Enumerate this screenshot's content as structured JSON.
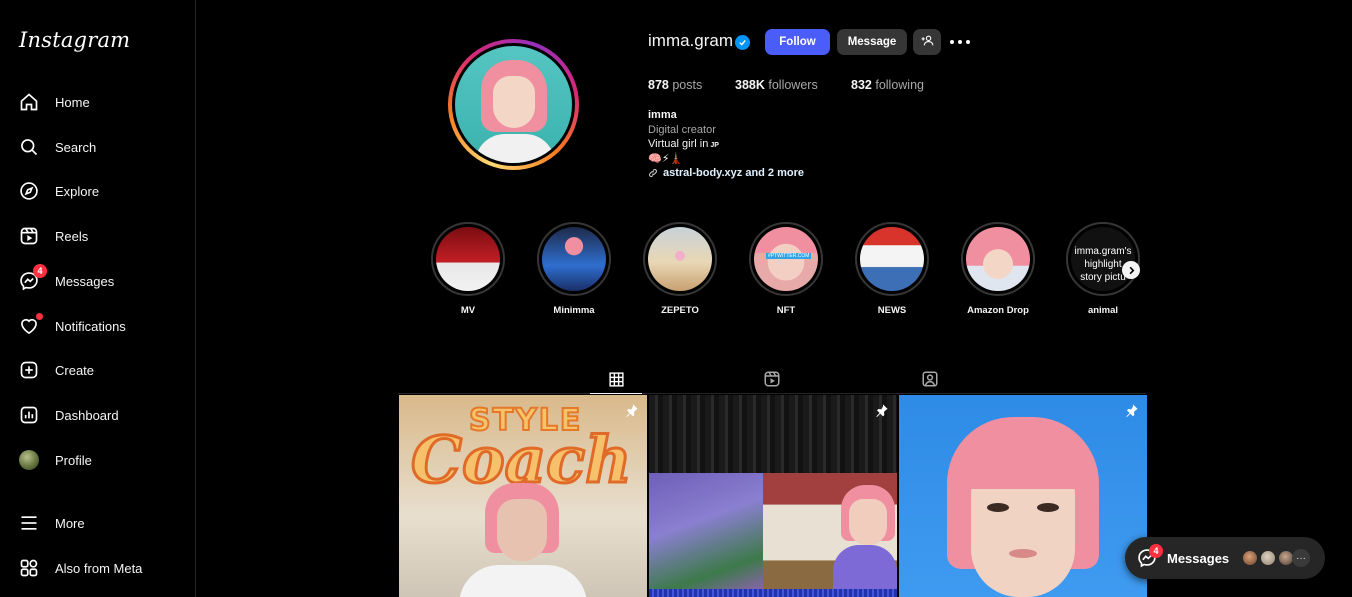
{
  "sidebar": {
    "logo": "Instagram",
    "items": [
      {
        "label": "Home",
        "icon": "home-icon"
      },
      {
        "label": "Search",
        "icon": "search-icon"
      },
      {
        "label": "Explore",
        "icon": "compass-icon"
      },
      {
        "label": "Reels",
        "icon": "reels-icon"
      },
      {
        "label": "Messages",
        "icon": "messenger-icon",
        "badge": "4"
      },
      {
        "label": "Notifications",
        "icon": "heart-icon"
      },
      {
        "label": "Create",
        "icon": "plus-square-icon"
      },
      {
        "label": "Dashboard",
        "icon": "dashboard-icon"
      },
      {
        "label": "Profile",
        "icon": "profile-avatar"
      }
    ],
    "bottom": [
      {
        "label": "More",
        "icon": "menu-icon"
      },
      {
        "label": "Also from Meta",
        "icon": "meta-apps-icon"
      }
    ]
  },
  "profile": {
    "username": "imma.gram",
    "follow_label": "Follow",
    "message_label": "Message",
    "stats": {
      "posts_count": "878",
      "posts_label": "posts",
      "followers_count": "388K",
      "followers_label": "followers",
      "following_count": "832",
      "following_label": "following"
    },
    "bio": {
      "name": "imma",
      "category": "Digital creator",
      "line": "Virtual girl in",
      "country": "JP",
      "emoji": "🧠⚡🗼",
      "link": "astral-body.xyz and 2 more"
    }
  },
  "highlights": [
    {
      "label": "MV"
    },
    {
      "label": "Minimma"
    },
    {
      "label": "ZEPETO"
    },
    {
      "label": "NFT",
      "overlay": "#PTWITTER.COM"
    },
    {
      "label": "NEWS"
    },
    {
      "label": "Amazon Drop"
    },
    {
      "label": "animal",
      "overlay_lines": [
        "imma.gram's",
        "highlight",
        "story pictu"
      ]
    }
  ],
  "tabs": [
    {
      "icon": "grid-icon",
      "active": true
    },
    {
      "icon": "reels-icon",
      "active": false
    },
    {
      "icon": "tagged-icon",
      "active": false
    }
  ],
  "posts": [
    {
      "text_top": "STYLE",
      "text_main": "Coach",
      "pinned": true
    },
    {
      "pinned": true
    },
    {
      "pinned": true
    }
  ],
  "messages_pill": {
    "label": "Messages",
    "badge": "4",
    "more": "···"
  },
  "colors": {
    "accent": "#4a5df9",
    "badge": "#ff3040",
    "verified": "#0095f6",
    "button_dark": "#363636"
  }
}
